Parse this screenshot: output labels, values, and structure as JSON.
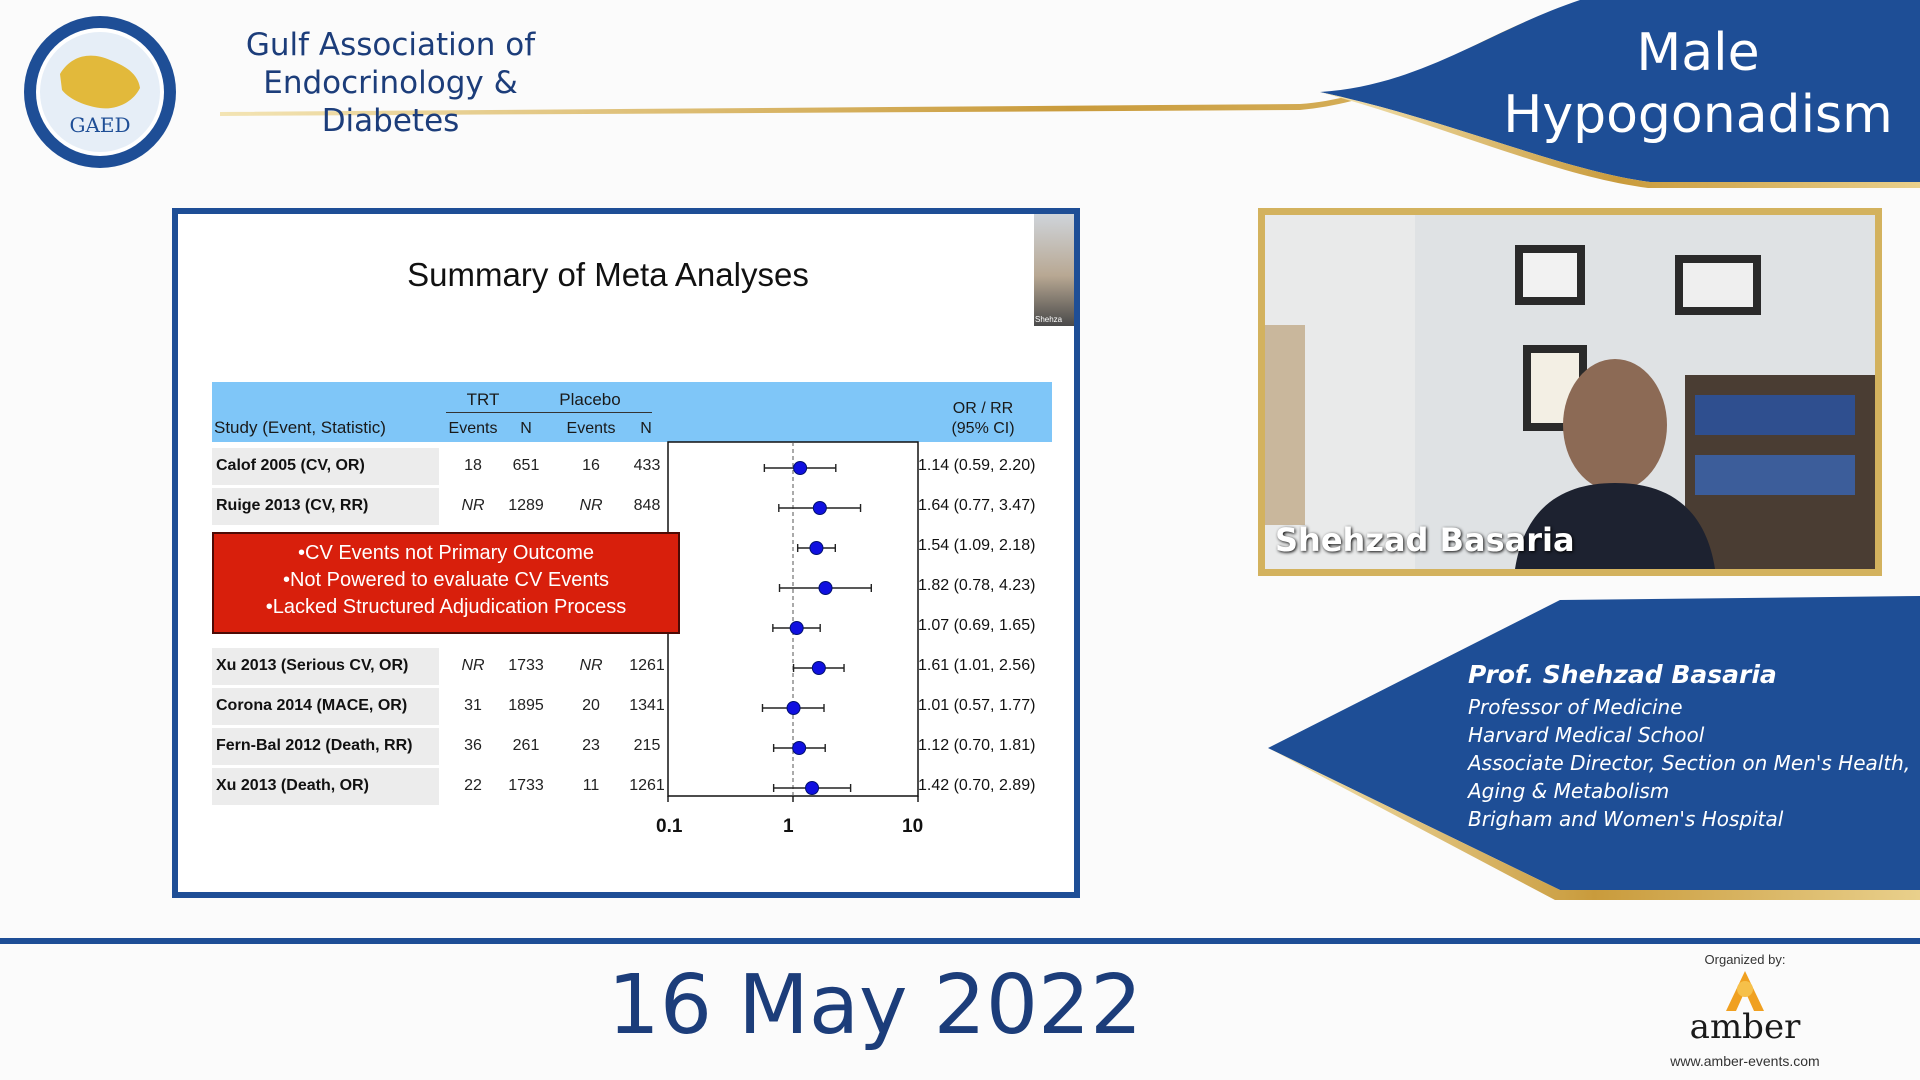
{
  "header": {
    "org_name_line1": "Gulf Association of",
    "org_name_line2": "Endocrinology & Diabetes",
    "logo_text": "GAED",
    "event_title_line1": "Male",
    "event_title_line2": "Hypogonadism"
  },
  "slide": {
    "title": "Summary of Meta Analyses",
    "thumb_label": "Shehza",
    "columns": {
      "study": "Study (Event, Statistic)",
      "trt": "TRT",
      "placebo": "Placebo",
      "events": "Events",
      "n": "N",
      "or_rr_line1": "OR / RR",
      "or_rr_line2": "(95% CI)"
    },
    "rows": [
      {
        "study": "Calof 2005 (CV, OR)",
        "trt_events": "18",
        "trt_n": "651",
        "pl_events": "16",
        "pl_n": "433",
        "ci": "1.14 (0.59, 2.20)"
      },
      {
        "study": "Ruige 2013 (CV, RR)",
        "trt_events": "NR",
        "trt_n": "1289",
        "pl_events": "NR",
        "pl_n": "848",
        "ci": "1.64 (0.77, 3.47)"
      },
      {
        "study": "",
        "trt_events": "",
        "trt_n": "",
        "pl_events": "",
        "pl_n": "",
        "ci": "1.54 (1.09, 2.18)"
      },
      {
        "study": "",
        "trt_events": "",
        "trt_n": "",
        "pl_events": "",
        "pl_n": "",
        "ci": "1.82 (0.78, 4.23)"
      },
      {
        "study": "",
        "trt_events": "",
        "trt_n": "",
        "pl_events": "",
        "pl_n": "",
        "ci": "1.07 (0.69, 1.65)"
      },
      {
        "study": "Xu 2013 (Serious CV, OR)",
        "trt_events": "NR",
        "trt_n": "1733",
        "pl_events": "NR",
        "pl_n": "1261",
        "ci": "1.61 (1.01, 2.56)"
      },
      {
        "study": "Corona 2014 (MACE, OR)",
        "trt_events": "31",
        "trt_n": "1895",
        "pl_events": "20",
        "pl_n": "1341",
        "ci": "1.01 (0.57, 1.77)"
      },
      {
        "study": "Fern-Bal 2012 (Death, RR)",
        "trt_events": "36",
        "trt_n": "261",
        "pl_events": "23",
        "pl_n": "215",
        "ci": "1.12 (0.70, 1.81)"
      },
      {
        "study": "Xu 2013 (Death, OR)",
        "trt_events": "22",
        "trt_n": "1733",
        "pl_events": "11",
        "pl_n": "1261",
        "ci": "1.42 (0.70, 2.89)"
      }
    ],
    "red_box": [
      "•CV Events not Primary Outcome",
      "•Not Powered to evaluate CV Events",
      "•Lacked Structured Adjudication Process"
    ],
    "axis_labels": [
      "0.1",
      "1",
      "10"
    ]
  },
  "chart_data": {
    "type": "scatter",
    "scale": "log",
    "xlim": [
      0.1,
      10
    ],
    "reference_line": 1,
    "points": [
      {
        "est": 1.14,
        "lo": 0.59,
        "hi": 2.2
      },
      {
        "est": 1.64,
        "lo": 0.77,
        "hi": 3.47
      },
      {
        "est": 1.54,
        "lo": 1.09,
        "hi": 2.18
      },
      {
        "est": 1.82,
        "lo": 0.78,
        "hi": 4.23
      },
      {
        "est": 1.07,
        "lo": 0.69,
        "hi": 1.65
      },
      {
        "est": 1.61,
        "lo": 1.01,
        "hi": 2.56
      },
      {
        "est": 1.01,
        "lo": 0.57,
        "hi": 1.77
      },
      {
        "est": 1.12,
        "lo": 0.7,
        "hi": 1.81
      },
      {
        "est": 1.42,
        "lo": 0.7,
        "hi": 2.89
      }
    ]
  },
  "video": {
    "speaker_name": "Shehzad Basaria"
  },
  "bio": {
    "name": "Prof. Shehzad Basaria",
    "lines": [
      "Professor of Medicine",
      "Harvard Medical School",
      "Associate Director, Section on Men's Health,",
      "Aging & Metabolism",
      "Brigham and Women's Hospital"
    ]
  },
  "footer": {
    "date": "16 May 2022",
    "organized_by": "Organized by:",
    "organizer_name": "amber",
    "organizer_url": "www.amber-events.com"
  },
  "colors": {
    "brand_blue": "#1e4e96",
    "gold": "#d3b25e",
    "red_box": "#d81f0c",
    "table_header": "#7fc6f8",
    "point": "#1010e0"
  }
}
